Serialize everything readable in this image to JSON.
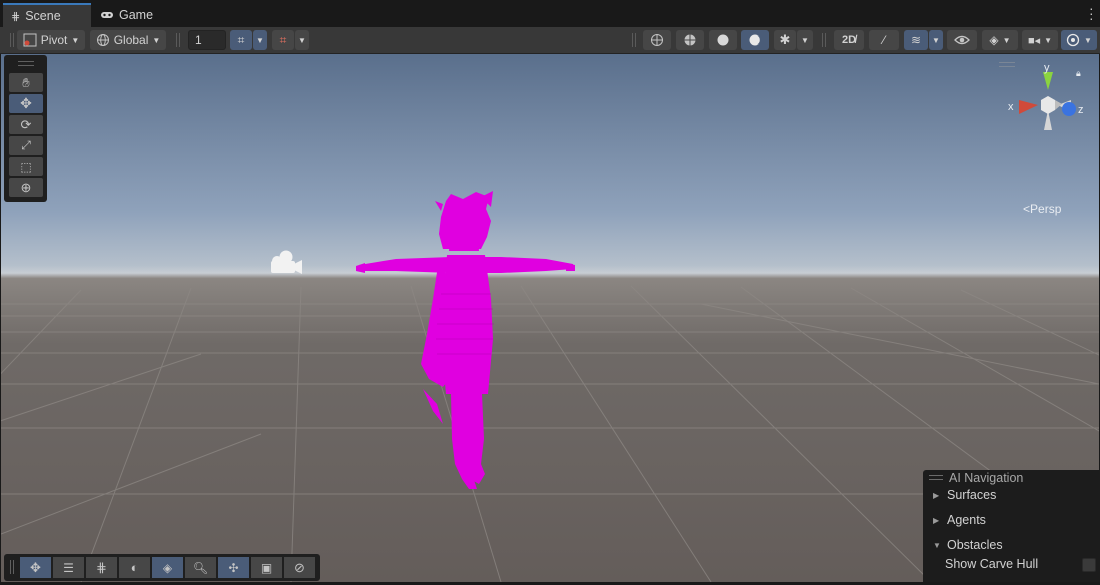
{
  "tabs": [
    {
      "label": "Scene",
      "icon": "grid-icon",
      "active": true
    },
    {
      "label": "Game",
      "icon": "gamepad-icon",
      "active": false
    }
  ],
  "toolbar": {
    "pivot_label": "Pivot",
    "global_label": "Global",
    "grid_size_value": "1"
  },
  "gizmo": {
    "axis_x": "x",
    "axis_y": "y",
    "axis_z": "z",
    "projection_label": "Persp",
    "colors": {
      "x": "#d04a3a",
      "y": "#8bd43f",
      "z": "#3a73e0"
    }
  },
  "tools": [
    "hand-tool",
    "move-tool",
    "rotate-tool",
    "scale-tool",
    "rect-tool",
    "transform-tool"
  ],
  "nav_overlay": {
    "title": "AI Navigation",
    "items": [
      {
        "label": "Surfaces",
        "expanded": false
      },
      {
        "label": "Agents",
        "expanded": false
      },
      {
        "label": "Obstacles",
        "expanded": true
      }
    ],
    "show_carve_hull_label": "Show Carve Hull",
    "show_carve_hull_checked": false
  },
  "accent_colors": {
    "selected": "#4a5c78",
    "model": "#e000e0",
    "tab_underline": "#3a79bb"
  }
}
